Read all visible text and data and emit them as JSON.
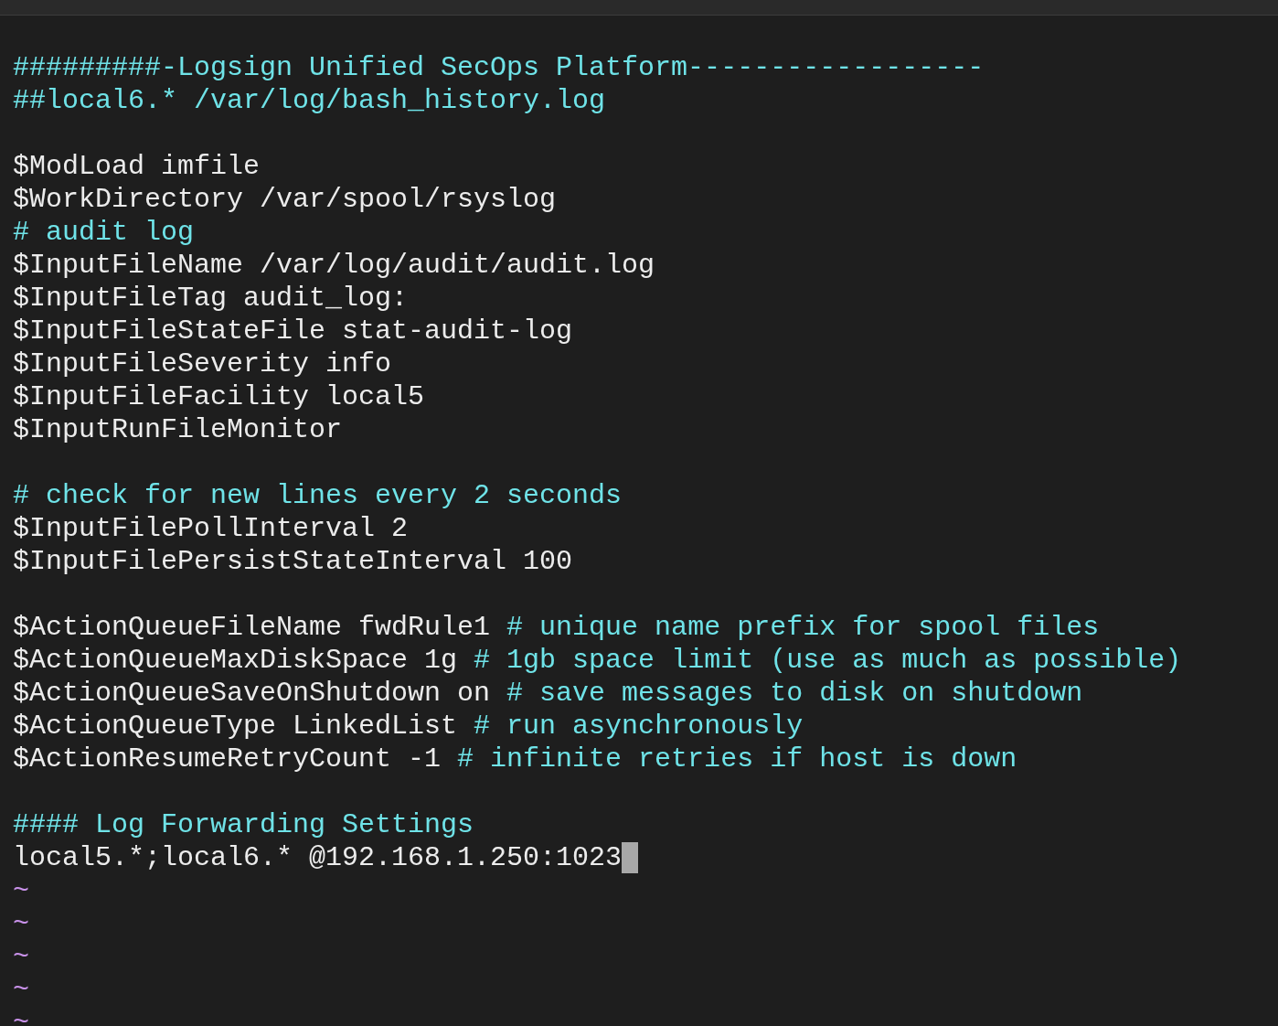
{
  "editor": {
    "lines": [
      {
        "kind": "text",
        "segments": [
          {
            "kind": "comment",
            "text": "#########-Logsign Unified SecOps Platform------------------"
          }
        ]
      },
      {
        "kind": "text",
        "segments": [
          {
            "kind": "comment",
            "text": "##local6.* /var/log/bash_history.log"
          }
        ]
      },
      {
        "kind": "blank"
      },
      {
        "kind": "text",
        "segments": [
          {
            "kind": "code",
            "text": "$ModLoad imfile"
          }
        ]
      },
      {
        "kind": "text",
        "segments": [
          {
            "kind": "code",
            "text": "$WorkDirectory /var/spool/rsyslog"
          }
        ]
      },
      {
        "kind": "text",
        "segments": [
          {
            "kind": "comment",
            "text": "# audit log"
          }
        ]
      },
      {
        "kind": "text",
        "segments": [
          {
            "kind": "code",
            "text": "$InputFileName /var/log/audit/audit.log"
          }
        ]
      },
      {
        "kind": "text",
        "segments": [
          {
            "kind": "code",
            "text": "$InputFileTag audit_log:"
          }
        ]
      },
      {
        "kind": "text",
        "segments": [
          {
            "kind": "code",
            "text": "$InputFileStateFile stat-audit-log"
          }
        ]
      },
      {
        "kind": "text",
        "segments": [
          {
            "kind": "code",
            "text": "$InputFileSeverity info"
          }
        ]
      },
      {
        "kind": "text",
        "segments": [
          {
            "kind": "code",
            "text": "$InputFileFacility local5"
          }
        ]
      },
      {
        "kind": "text",
        "segments": [
          {
            "kind": "code",
            "text": "$InputRunFileMonitor"
          }
        ]
      },
      {
        "kind": "blank"
      },
      {
        "kind": "text",
        "segments": [
          {
            "kind": "comment",
            "text": "# check for new lines every 2 seconds"
          }
        ]
      },
      {
        "kind": "text",
        "segments": [
          {
            "kind": "code",
            "text": "$InputFilePollInterval 2"
          }
        ]
      },
      {
        "kind": "text",
        "segments": [
          {
            "kind": "code",
            "text": "$InputFilePersistStateInterval 100"
          }
        ]
      },
      {
        "kind": "blank"
      },
      {
        "kind": "text",
        "segments": [
          {
            "kind": "code",
            "text": "$ActionQueueFileName fwdRule1"
          },
          {
            "kind": "comment",
            "text": "# unique name prefix for spool files"
          }
        ]
      },
      {
        "kind": "text",
        "segments": [
          {
            "kind": "code",
            "text": "$ActionQueueMaxDiskSpace 1g"
          },
          {
            "kind": "comment",
            "text": "# 1gb space limit (use as much as possible)"
          }
        ]
      },
      {
        "kind": "text",
        "segments": [
          {
            "kind": "code",
            "text": "$ActionQueueSaveOnShutdown on"
          },
          {
            "kind": "comment",
            "text": "# save messages to disk on shutdown"
          }
        ]
      },
      {
        "kind": "text",
        "segments": [
          {
            "kind": "code",
            "text": "$ActionQueueType LinkedList"
          },
          {
            "kind": "comment",
            "text": "# run asynchronously"
          }
        ]
      },
      {
        "kind": "text",
        "segments": [
          {
            "kind": "code",
            "text": "$ActionResumeRetryCount -1"
          },
          {
            "kind": "comment",
            "text": "# infinite retries if host is down"
          }
        ]
      },
      {
        "kind": "blank"
      },
      {
        "kind": "text",
        "segments": [
          {
            "kind": "comment",
            "text": "#### Log Forwarding Settings"
          }
        ]
      },
      {
        "kind": "text",
        "cursor": true,
        "segments": [
          {
            "kind": "code",
            "text": "local5.*;local6.* @192.168.1.250:1023"
          }
        ]
      },
      {
        "kind": "tilde",
        "text": "~"
      },
      {
        "kind": "tilde",
        "text": "~"
      },
      {
        "kind": "tilde",
        "text": "~"
      },
      {
        "kind": "tilde",
        "text": "~"
      },
      {
        "kind": "tilde",
        "text": "~"
      }
    ]
  }
}
